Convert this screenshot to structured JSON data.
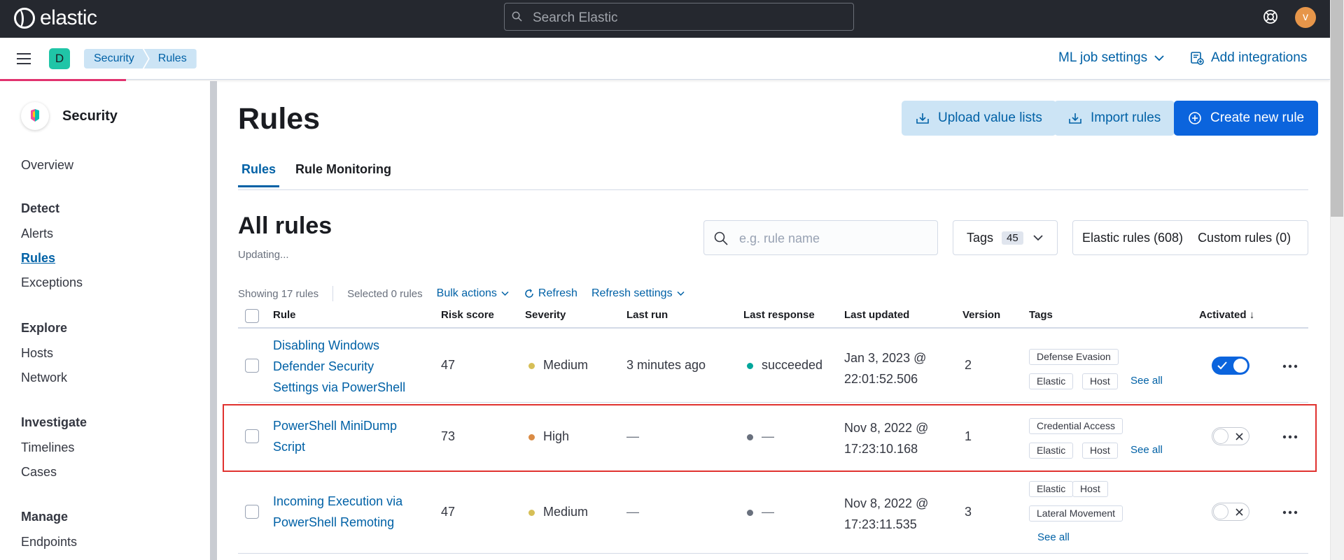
{
  "header": {
    "brand": "elastic",
    "search_placeholder": "Search Elastic",
    "avatar_initial": "v"
  },
  "subheader": {
    "space_initial": "D",
    "breadcrumbs": [
      "Security",
      "Rules"
    ],
    "ml_job_settings": "ML job settings",
    "add_integrations": "Add integrations"
  },
  "sidebar": {
    "title": "Security",
    "overview": "Overview",
    "groups": [
      {
        "label": "Detect",
        "items": [
          "Alerts",
          "Rules",
          "Exceptions"
        ]
      },
      {
        "label": "Explore",
        "items": [
          "Hosts",
          "Network"
        ]
      },
      {
        "label": "Investigate",
        "items": [
          "Timelines",
          "Cases"
        ]
      },
      {
        "label": "Manage",
        "items": [
          "Endpoints"
        ]
      }
    ],
    "active_item": "Rules"
  },
  "main": {
    "title": "Rules",
    "buttons": {
      "upload_value_lists": "Upload value lists",
      "import_rules": "Import rules",
      "create_new_rule": "Create new rule"
    },
    "tabs": [
      "Rules",
      "Rule Monitoring"
    ],
    "section_title": "All rules",
    "status": "Updating...",
    "search_placeholder": "e.g. rule name",
    "tags_label": "Tags",
    "tags_count": "45",
    "elastic_rules": "Elastic rules (608)",
    "custom_rules": "Custom rules (0)",
    "showing": "Showing 17 rules",
    "selected": "Selected 0 rules",
    "bulk_actions": "Bulk actions",
    "refresh": "Refresh",
    "refresh_settings": "Refresh settings"
  },
  "table": {
    "columns": [
      "Rule",
      "Risk score",
      "Severity",
      "Last run",
      "Last response",
      "Last updated",
      "Version",
      "Tags",
      "Activated"
    ],
    "sort_indicator": "↓",
    "rows": [
      {
        "rule_lines": [
          "Disabling Windows",
          "Defender Security",
          "Settings via PowerShell"
        ],
        "risk_score": "47",
        "severity": "Medium",
        "severity_color": "#d6bf57",
        "last_run": "3 minutes ago",
        "last_response": "succeeded",
        "response_color": "#00a69b",
        "updated_lines": [
          "Jan 3, 2023 @",
          "22:01:52.506"
        ],
        "version": "2",
        "tags": [
          "Defense Evasion",
          "Elastic",
          "Host"
        ],
        "see_all": "See all",
        "activated": true
      },
      {
        "rule_lines": [
          "PowerShell MiniDump",
          "Script"
        ],
        "risk_score": "73",
        "severity": "High",
        "severity_color": "#da8b45",
        "last_run": "—",
        "last_response": "—",
        "response_color": "#69707d",
        "updated_lines": [
          "Nov 8, 2022 @",
          "17:23:10.168"
        ],
        "version": "1",
        "tags": [
          "Credential Access",
          "Elastic",
          "Host"
        ],
        "see_all": "See all",
        "activated": false
      },
      {
        "rule_lines": [
          "Incoming Execution via",
          "PowerShell Remoting"
        ],
        "risk_score": "47",
        "severity": "Medium",
        "severity_color": "#d6bf57",
        "last_run": "—",
        "last_response": "—",
        "response_color": "#69707d",
        "updated_lines": [
          "Nov 8, 2022 @",
          "17:23:11.535"
        ],
        "version": "3",
        "tags": [
          "Elastic",
          "Host",
          "Lateral Movement"
        ],
        "see_all": "See all",
        "activated": false
      }
    ]
  },
  "colors": {
    "header_bg": "#25282f",
    "link": "#0061a6",
    "primary": "#0b64dd",
    "highlight_border": "#e0322f"
  }
}
